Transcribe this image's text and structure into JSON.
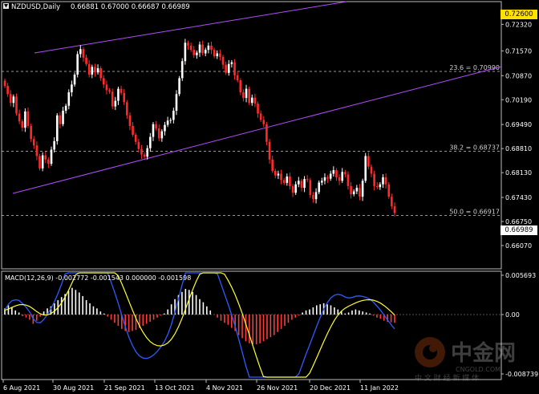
{
  "header": {
    "symbol": "NZDUSD,Daily",
    "ohlc": "0.66881 0.67000 0.66687 0.66989"
  },
  "price_axis": {
    "top_marker": "0.72600",
    "current_marker": "0.66989",
    "ticks": [
      "0.72320",
      "0.71570",
      "0.70870",
      "0.70190",
      "0.69490",
      "0.68810",
      "0.68130",
      "0.67430",
      "0.66750",
      "0.66070"
    ]
  },
  "fib_levels": [
    {
      "label": "23.6 = 0.70990",
      "price": 0.7099
    },
    {
      "label": "38.2 = 0.68737",
      "price": 0.68737
    },
    {
      "label": "50.0 = 0.66917",
      "price": 0.66917
    }
  ],
  "macd": {
    "label": "MACD(12,26,9) -0.002772 -0.001543 0.000000 -0.001598",
    "ticks": [
      "0.005693",
      "0.00",
      "-0.008739"
    ]
  },
  "time_axis": {
    "labels": [
      "6 Aug 2021",
      "30 Aug 2021",
      "21 Sep 2021",
      "13 Oct 2021",
      "4 Nov 2021",
      "26 Nov 2021",
      "20 Dec 2021",
      "11 Jan 2022"
    ]
  },
  "watermark": {
    "brand": "中金网",
    "domain": "CNGOLD.COM",
    "tagline": "中 文 财 经 新 媒 体"
  },
  "colors": {
    "background": "#000000",
    "bull_candle": "#ffffff",
    "bear_candle": "#ff2a2a",
    "channel": "#b44cff",
    "fib_line": "#c8c8c8",
    "macd_main": "#2f5bff",
    "macd_signal": "#ffff33",
    "marker_yellow": "#ffe000"
  },
  "chart_data": {
    "type": "candlestick",
    "symbol": "NZDUSD",
    "timeframe": "Daily",
    "last_close": 0.66989,
    "closes": [
      0.7058,
      0.7035,
      0.701,
      0.7028,
      0.698,
      0.6958,
      0.694,
      0.6986,
      0.6945,
      0.6908,
      0.689,
      0.686,
      0.6825,
      0.6862,
      0.685,
      0.6838,
      0.6878,
      0.6902,
      0.6975,
      0.695,
      0.6988,
      0.7002,
      0.704,
      0.7062,
      0.709,
      0.7148,
      0.7162,
      0.7138,
      0.712,
      0.709,
      0.7112,
      0.7096,
      0.7108,
      0.708,
      0.7062,
      0.7046,
      0.7042,
      0.7,
      0.7016,
      0.705,
      0.7038,
      0.7012,
      0.6975,
      0.6945,
      0.692,
      0.69,
      0.688,
      0.6864,
      0.6858,
      0.6882,
      0.6914,
      0.695,
      0.6938,
      0.691,
      0.693,
      0.6948,
      0.696,
      0.6962,
      0.6988,
      0.7035,
      0.708,
      0.7128,
      0.718,
      0.7172,
      0.716,
      0.7145,
      0.7152,
      0.7175,
      0.715,
      0.716,
      0.7172,
      0.716,
      0.7142,
      0.715,
      0.714,
      0.7118,
      0.7095,
      0.712,
      0.7125,
      0.7088,
      0.7074,
      0.704,
      0.7024,
      0.705,
      0.701,
      0.7025,
      0.7008,
      0.698,
      0.6962,
      0.695,
      0.69,
      0.685,
      0.6818,
      0.6805,
      0.681,
      0.6792,
      0.6784,
      0.6802,
      0.6775,
      0.6756,
      0.678,
      0.679,
      0.677,
      0.6795,
      0.6792,
      0.675,
      0.6738,
      0.6758,
      0.6785,
      0.679,
      0.68,
      0.6796,
      0.681,
      0.682,
      0.68,
      0.679,
      0.6815,
      0.6808,
      0.6775,
      0.6752,
      0.676,
      0.677,
      0.6745,
      0.679,
      0.686,
      0.683,
      0.681,
      0.6775,
      0.6772,
      0.678,
      0.68,
      0.678,
      0.6745,
      0.6718,
      0.6699
    ],
    "macd_histogram": [
      0.0012,
      0.0018,
      0.0014,
      0.0008,
      0.0004,
      -0.0003,
      -0.0006,
      -0.001,
      -0.0018,
      -0.0012,
      -0.0004,
      0.0006,
      0.0012,
      0.0016,
      0.0022,
      0.0028,
      0.0034,
      0.004,
      0.0046,
      0.0052,
      0.0048,
      0.0043,
      0.0036,
      0.0028,
      0.0022,
      0.0016,
      0.0012,
      0.0006,
      0.0002,
      -0.0004,
      -0.001,
      -0.0016,
      -0.0022,
      -0.0028,
      -0.0032,
      -0.0034,
      -0.0032,
      -0.003,
      -0.0026,
      -0.0022,
      -0.0018,
      -0.0014,
      -0.001,
      -0.0006,
      -0.0002,
      0.0002,
      0.001,
      0.002,
      0.003,
      0.0038,
      0.0044,
      0.005,
      0.0048,
      0.0044,
      0.0038,
      0.003,
      0.0024,
      0.0016,
      0.0008,
      0.0,
      -0.0006,
      -0.0012,
      -0.0016,
      -0.002,
      -0.0026,
      -0.0032,
      -0.004,
      -0.0046,
      -0.0052,
      -0.0056,
      -0.0058,
      -0.0058,
      -0.0056,
      -0.0052,
      -0.0048,
      -0.0044,
      -0.004,
      -0.0034,
      -0.0028,
      -0.0022,
      -0.0016,
      -0.001,
      -0.0006,
      -0.0002,
      0.0004,
      0.0008,
      0.001,
      0.0014,
      0.0018,
      0.002,
      0.0022,
      0.002,
      0.0018,
      0.0014,
      0.001,
      0.0006,
      0.0002,
      0.0004,
      0.0008,
      0.001,
      0.0008,
      0.0006,
      0.0004,
      0.0002,
      -0.0002,
      -0.0006,
      -0.0008,
      -0.0012,
      -0.0014,
      -0.0015,
      -0.0016
    ]
  }
}
